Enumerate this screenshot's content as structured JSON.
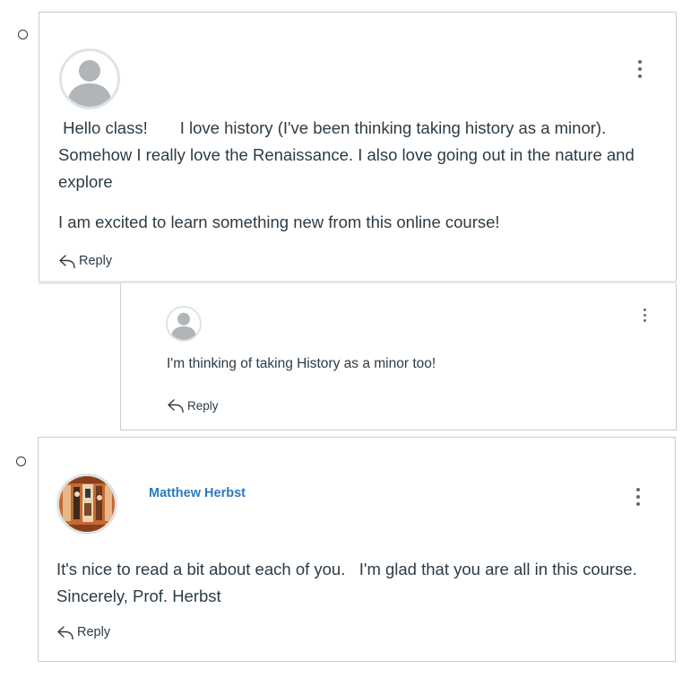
{
  "posts": [
    {
      "paragraphs": [
        " Hello class!       I love history (I've been thinking taking history as a minor). Somehow I really love the Renaissance. I also love going out in the nature and explore",
        "I am excited to learn something new from this online course!"
      ],
      "reply_label": "Reply"
    },
    {
      "paragraphs": [
        "I'm thinking of taking History as a minor too!"
      ],
      "reply_label": "Reply"
    },
    {
      "author": "Matthew Herbst",
      "paragraphs": [
        "It's nice to read a bit about each of you.   I'm glad that you are all in this course.   Sincerely, Prof. Herbst"
      ],
      "reply_label": "Reply"
    }
  ],
  "icons": {
    "avatar_placeholder": "default-user-icon",
    "menu": "more-options-icon",
    "reply": "reply-arrow-icon"
  },
  "colors": {
    "author_link": "#2b7abc",
    "text": "#2d3b45",
    "border": "#c7cdd1"
  }
}
